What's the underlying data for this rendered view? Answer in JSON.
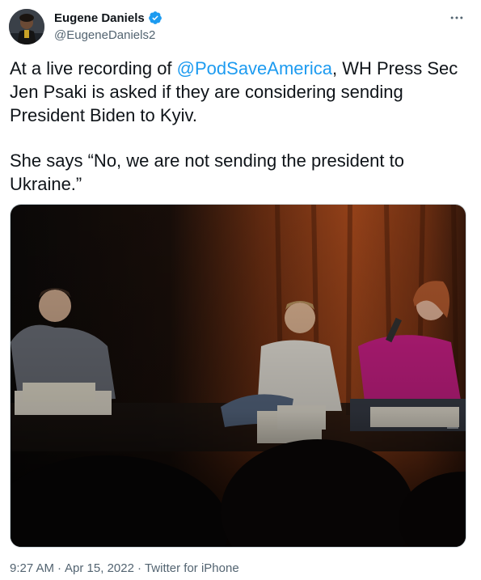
{
  "author": {
    "display_name": "Eugene Daniels",
    "handle": "@EugeneDaniels2",
    "verified": true,
    "avatar_icon": "profile-photo"
  },
  "tweet": {
    "line1_prefix": "At a live recording of ",
    "mention": "@PodSaveAmerica",
    "line1_suffix": ", WH Press Sec Jen Psaki is asked if they are considering sending President Biden to Kyiv.",
    "paragraph2": "She says “No, we are not sending the president to Ukraine.”"
  },
  "media": {
    "kind": "photo",
    "alt_icon": "stage-photo"
  },
  "meta": {
    "time": "9:27 AM",
    "separator": "·",
    "date": "Apr 15, 2022",
    "source": "Twitter for iPhone"
  },
  "colors": {
    "link": "#1d9bf0",
    "text": "#0f1419",
    "secondary": "#536471",
    "verified": "#1d9bf0"
  },
  "icons": {
    "more": "more-horizontal-icon",
    "verified": "verified-badge-icon"
  }
}
